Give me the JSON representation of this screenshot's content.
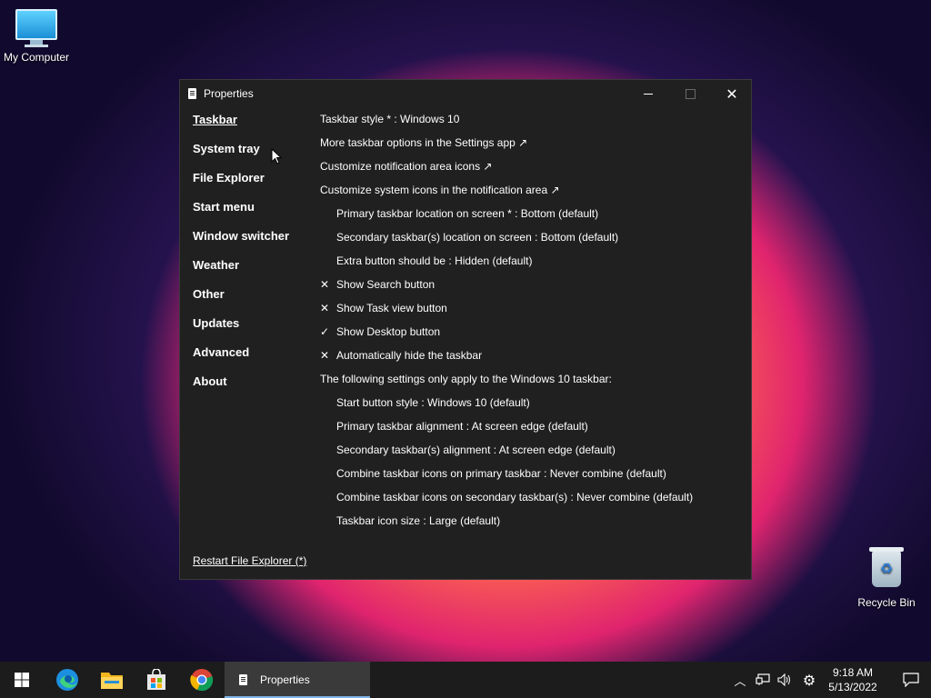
{
  "desktop": {
    "my_computer_label": "My Computer",
    "recycle_bin_label": "Recycle Bin"
  },
  "window": {
    "title": "Properties",
    "nav": [
      {
        "label": "Taskbar",
        "active": true
      },
      {
        "label": "System tray"
      },
      {
        "label": "File Explorer"
      },
      {
        "label": "Start menu"
      },
      {
        "label": "Window switcher"
      },
      {
        "label": "Weather"
      },
      {
        "label": "Other"
      },
      {
        "label": "Updates"
      },
      {
        "label": "Advanced"
      },
      {
        "label": "About"
      }
    ],
    "restart_label": "Restart File Explorer (*)",
    "settings": [
      {
        "text": "Taskbar style * : Windows 10",
        "indent": false,
        "mark": ""
      },
      {
        "text": "More taskbar options in the Settings app ↗",
        "indent": false,
        "mark": ""
      },
      {
        "text": "Customize notification area icons ↗",
        "indent": false,
        "mark": ""
      },
      {
        "text": "Customize system icons in the notification area ↗",
        "indent": false,
        "mark": ""
      },
      {
        "text": "Primary taskbar location on screen * : Bottom (default)",
        "indent": true,
        "mark": ""
      },
      {
        "text": "Secondary taskbar(s) location on screen : Bottom (default)",
        "indent": true,
        "mark": ""
      },
      {
        "text": "Extra button should be : Hidden (default)",
        "indent": true,
        "mark": ""
      },
      {
        "text": "Show Search button",
        "indent": false,
        "mark": "✕"
      },
      {
        "text": "Show Task view button",
        "indent": false,
        "mark": "✕"
      },
      {
        "text": "Show Desktop button",
        "indent": false,
        "mark": "✓"
      },
      {
        "text": "Automatically hide the taskbar",
        "indent": false,
        "mark": "✕"
      },
      {
        "text": "The following settings only apply to the Windows 10 taskbar:",
        "indent": false,
        "mark": ""
      },
      {
        "text": "Start button style : Windows 10 (default)",
        "indent": true,
        "mark": ""
      },
      {
        "text": "Primary taskbar alignment : At screen edge (default)",
        "indent": true,
        "mark": ""
      },
      {
        "text": "Secondary taskbar(s) alignment : At screen edge (default)",
        "indent": true,
        "mark": ""
      },
      {
        "text": "Combine taskbar icons on primary taskbar : Never combine (default)",
        "indent": true,
        "mark": ""
      },
      {
        "text": "Combine taskbar icons on secondary taskbar(s) : Never combine (default)",
        "indent": true,
        "mark": ""
      },
      {
        "text": "Taskbar icon size : Large (default)",
        "indent": true,
        "mark": ""
      }
    ]
  },
  "taskbar": {
    "active_app_label": "Properties",
    "pinned": [
      "start-icon",
      "edge-icon",
      "file-explorer-icon",
      "store-icon",
      "chrome-icon"
    ],
    "time": "9:18 AM",
    "date": "5/13/2022",
    "accent": "#7fb3e6"
  }
}
